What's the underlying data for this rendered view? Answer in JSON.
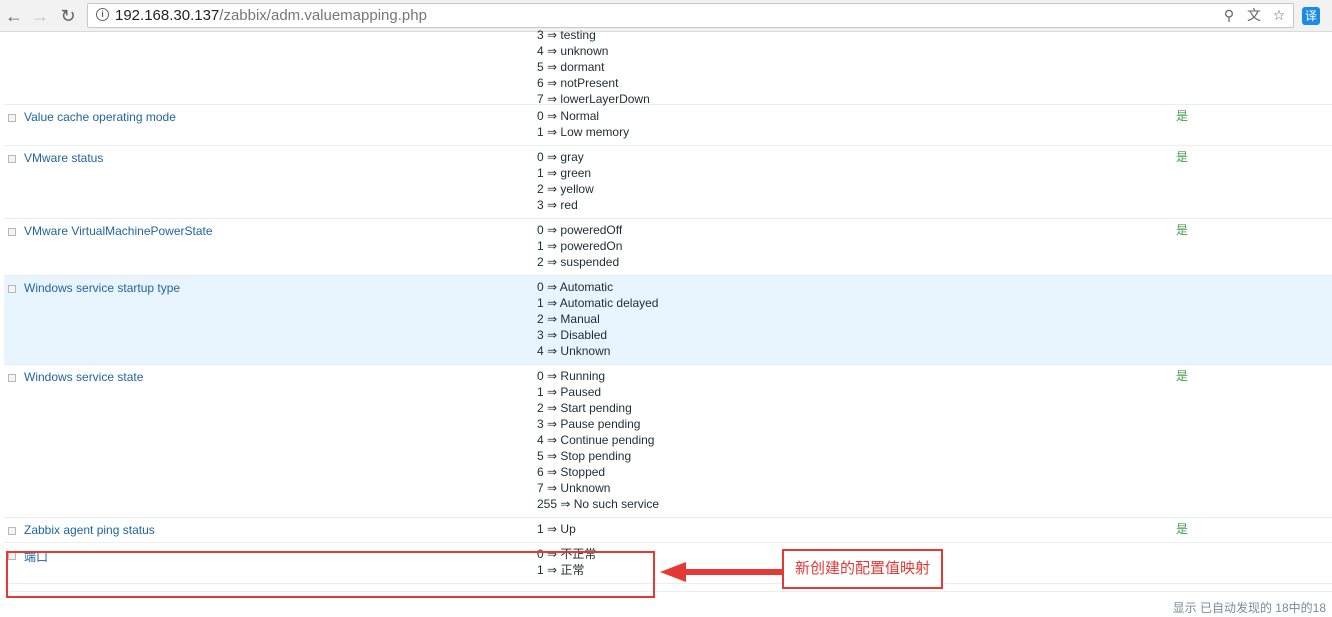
{
  "browser": {
    "url_host": "192.168.30.137",
    "url_path": "/zabbix/adm.valuemapping.php",
    "translate_label": "译"
  },
  "rows": [
    {
      "name": "",
      "mappings": [
        "3 ⇒ testing",
        "4 ⇒ unknown",
        "5 ⇒ dormant",
        "6 ⇒ notPresent",
        "7 ⇒ lowerLayerDown"
      ],
      "in_use": "",
      "top": 0
    },
    {
      "name": "Value cache operating mode",
      "mappings": [
        "0 ⇒ Normal",
        "1 ⇒ Low memory"
      ],
      "in_use": "是"
    },
    {
      "name": "VMware status",
      "mappings": [
        "0 ⇒ gray",
        "1 ⇒ green",
        "2 ⇒ yellow",
        "3 ⇒ red"
      ],
      "in_use": "是"
    },
    {
      "name": "VMware VirtualMachinePowerState",
      "mappings": [
        "0 ⇒ poweredOff",
        "1 ⇒ poweredOn",
        "2 ⇒ suspended"
      ],
      "in_use": "是"
    },
    {
      "name": "Windows service startup type",
      "mappings": [
        "0 ⇒ Automatic",
        "1 ⇒ Automatic delayed",
        "2 ⇒ Manual",
        "3 ⇒ Disabled",
        "4 ⇒ Unknown"
      ],
      "in_use": ""
    },
    {
      "name": "Windows service state",
      "mappings": [
        "0 ⇒ Running",
        "1 ⇒ Paused",
        "2 ⇒ Start pending",
        "3 ⇒ Pause pending",
        "4 ⇒ Continue pending",
        "5 ⇒ Stop pending",
        "6 ⇒ Stopped",
        "7 ⇒ Unknown",
        "255 ⇒ No such service"
      ],
      "in_use": "是"
    },
    {
      "name": "Zabbix agent ping status",
      "mappings": [
        "1 ⇒ Up"
      ],
      "in_use": "是"
    },
    {
      "name": "端口",
      "mappings": [
        "0 ⇒ 不正常",
        "1 ⇒ 正常"
      ],
      "in_use": ""
    }
  ],
  "footer": "显示 已自动发现的 18中的18",
  "annotation": {
    "label": "新创建的配置值映射",
    "color": "#e53935"
  }
}
